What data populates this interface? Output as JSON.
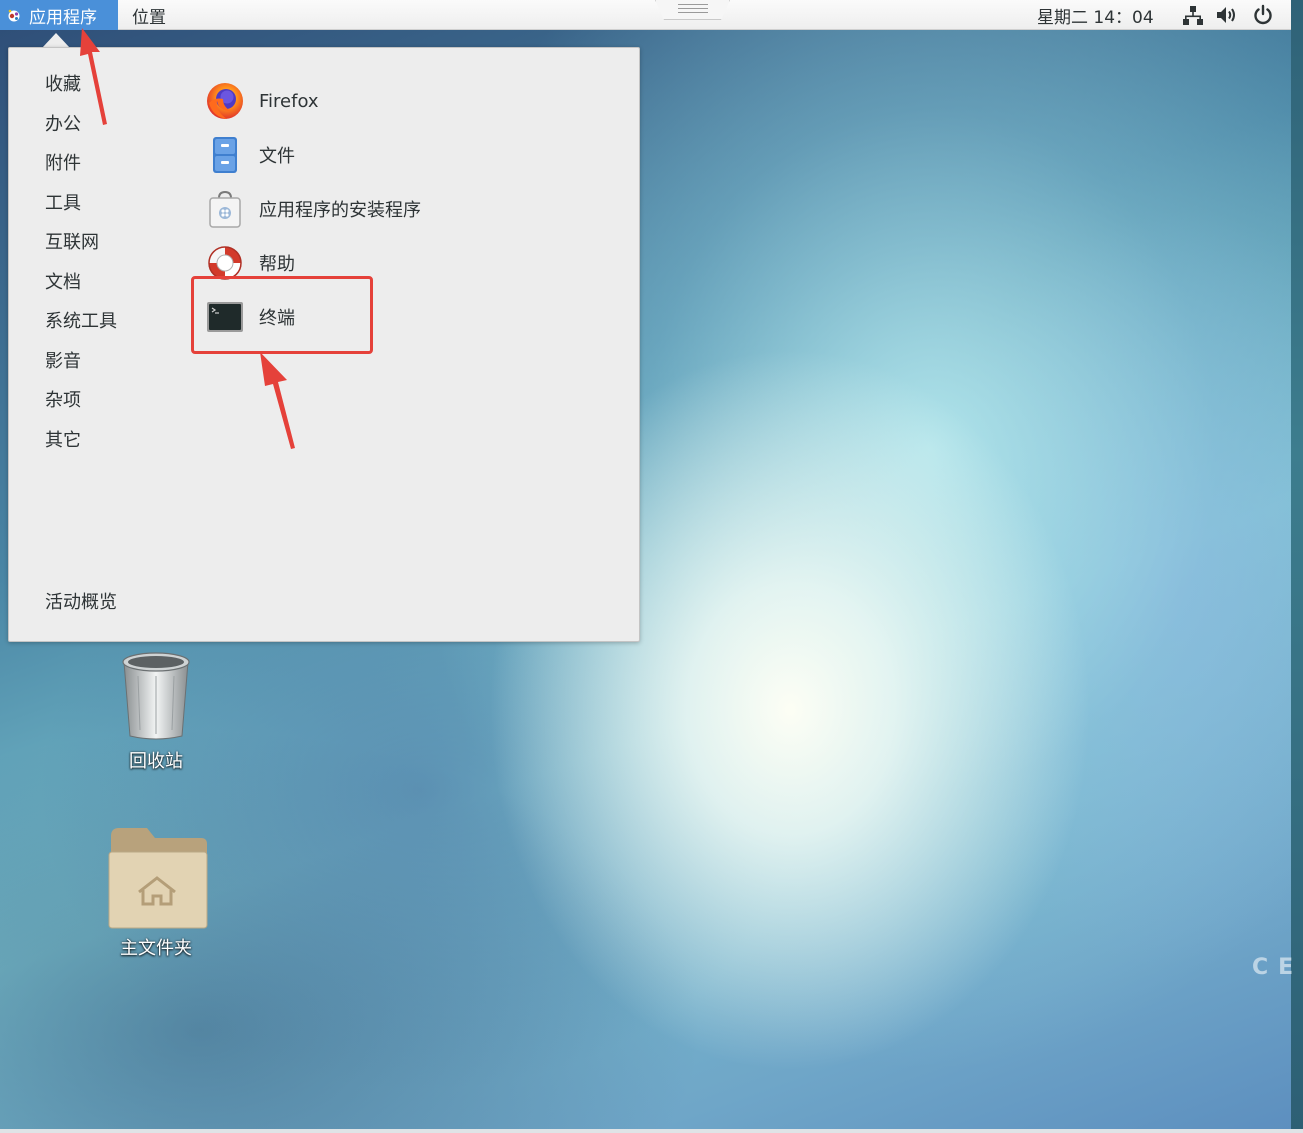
{
  "topbar": {
    "applications_label": "应用程序",
    "places_label": "位置",
    "clock": "星期二 14：04",
    "tray_icons": [
      "network-icon",
      "volume-icon",
      "power-icon"
    ]
  },
  "menu": {
    "categories": [
      {
        "label": "收藏"
      },
      {
        "label": "办公"
      },
      {
        "label": "附件"
      },
      {
        "label": "工具"
      },
      {
        "label": "互联网"
      },
      {
        "label": "文档"
      },
      {
        "label": "系统工具"
      },
      {
        "label": "影音"
      },
      {
        "label": "杂项"
      },
      {
        "label": "其它"
      }
    ],
    "activities_label": "活动概览",
    "apps": [
      {
        "label": "Firefox",
        "icon": "firefox-icon"
      },
      {
        "label": "文件",
        "icon": "file-cabinet-icon"
      },
      {
        "label": "应用程序的安装程序",
        "icon": "software-bag-icon"
      },
      {
        "label": "帮助",
        "icon": "lifebuoy-icon"
      },
      {
        "label": "终端",
        "icon": "terminal-icon"
      }
    ]
  },
  "desktop": {
    "trash_label": "回收站",
    "home_label": "主文件夹",
    "watermark": "CE"
  },
  "colors": {
    "accent": "#4a90d9",
    "highlight": "#e5413a",
    "menu_bg": "#ededed"
  }
}
